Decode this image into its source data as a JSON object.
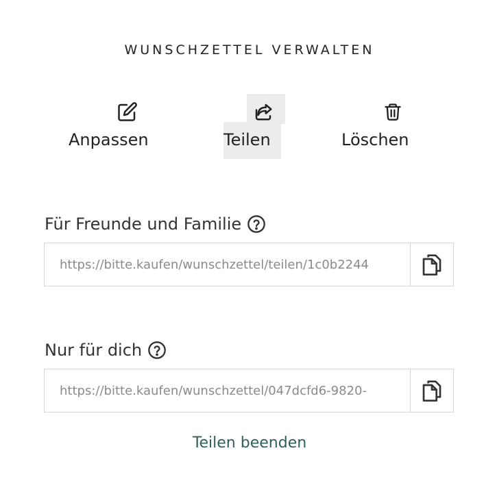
{
  "title": "WUNSCHZETTEL VERWALTEN",
  "actions": {
    "edit_label": "Anpassen",
    "share_label": "Teilen",
    "delete_label": "Löschen"
  },
  "sections": [
    {
      "label": "Für Freunde und Familie",
      "url": "https://bitte.kaufen/wunschzettel/teilen/1c0b2244"
    },
    {
      "label": "Nur für dich",
      "url": "https://bitte.kaufen/wunschzettel/047dcfd6-9820-"
    }
  ],
  "end_share_label": "Teilen beenden",
  "icons": [
    "edit-icon",
    "share-icon",
    "trash-icon",
    "help-icon",
    "copy-icon"
  ],
  "colors": {
    "text": "#222222",
    "link": "#2f5f5a",
    "border": "#d6d6d6",
    "highlight": "#ececec",
    "muted": "#8a8a8a"
  }
}
